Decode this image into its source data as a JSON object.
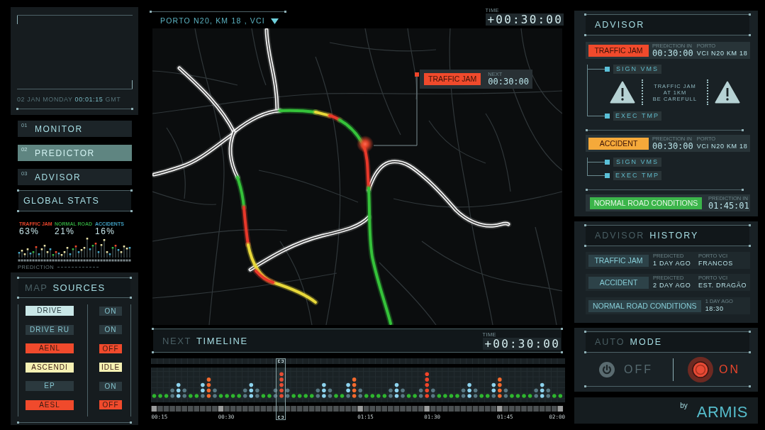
{
  "clock": {
    "date": "02 JAN MONDAY",
    "time": "00:01:15",
    "zone": "GMT"
  },
  "nav": [
    {
      "number": "01",
      "label": "MONITOR",
      "selected": false
    },
    {
      "number": "02",
      "label": "PREDICTOR",
      "selected": true
    },
    {
      "number": "03",
      "label": "ADVISOR",
      "selected": false
    }
  ],
  "global_stats": {
    "title": "GLOBAL STATS",
    "stats": [
      {
        "label": "TRAFFIC JAM",
        "value": "63%",
        "color": "#e8452c"
      },
      {
        "label": "NORMAL ROAD",
        "value": "21%",
        "color": "#2e9e3a"
      },
      {
        "label": "ACCIDENTS",
        "value": "16%",
        "color": "#3f9ec0"
      }
    ],
    "chart_label": "PREDICTION"
  },
  "map_sources": {
    "title_prefix": "MAP",
    "title": "SOURCES",
    "sources": [
      {
        "name": "DRIVE",
        "status": "ON",
        "color": "#2b393e",
        "selected": true
      },
      {
        "name": "DRIVE RU",
        "status": "ON",
        "color": "#2b393e",
        "selected": false
      },
      {
        "name": "AENL",
        "status": "OFF",
        "color": "#f04a2c",
        "selected": false
      },
      {
        "name": "ASCENDI",
        "status": "IDLE",
        "color": "#f5f1b3",
        "selected": false
      },
      {
        "name": "EP",
        "status": "ON",
        "color": "#2b393e",
        "selected": false
      },
      {
        "name": "AESL",
        "status": "OFF",
        "color": "#f04a2c",
        "selected": false
      }
    ]
  },
  "map": {
    "location": "PORTO N20, KM 18 , VCI",
    "time_label": "TIME",
    "time": "+00:30:00",
    "callout": {
      "event": "TRAFFIC JAM",
      "label": "NEXT",
      "time": "00:30:00"
    }
  },
  "timeline": {
    "title_prefix": "NEXT",
    "title": "TIMELINE",
    "time_label": "TIME",
    "time": "+00:30:00",
    "ticks": [
      "00:15",
      "00:30",
      "01:15",
      "01:30",
      "01:45",
      "02:00"
    ]
  },
  "advisor": {
    "title": "ADVISOR",
    "alerts": [
      {
        "event": "TRAFFIC JAM",
        "color": "#f04a2c",
        "fields": [
          {
            "label": "PREDICTION IN",
            "value": "00:30:00"
          },
          {
            "label": "PORTO",
            "value": "VCI N20 KM 18"
          }
        ],
        "actions": [
          {
            "kind": "button",
            "label": "SIGN VMS"
          },
          {
            "kind": "sign",
            "lines": [
              "TRAFFIC JAM",
              "AT 1KM",
              "BE CAREFULL"
            ]
          },
          {
            "kind": "button",
            "label": "EXEC TMP"
          }
        ]
      },
      {
        "event": "ACCIDENT",
        "color": "#f5a93a",
        "fields": [
          {
            "label": "PREDICTION IN",
            "value": "00:30:00"
          },
          {
            "label": "PORTO",
            "value": "VCI N20 KM 18"
          }
        ],
        "actions": [
          {
            "kind": "button",
            "label": "SIGN VMS"
          },
          {
            "kind": "button",
            "label": "EXEC TMP"
          }
        ]
      },
      {
        "event": "NORMAL ROAD CONDITIONS",
        "color": "#3bb54a",
        "fields": [
          {
            "label": "PREDICTION IN",
            "value": "01:45:01"
          }
        ]
      }
    ]
  },
  "history": {
    "title_prefix": "ADVISOR",
    "title": "HISTORY",
    "items": [
      {
        "event": "TRAFFIC JAM",
        "fields": [
          {
            "label": "PREDICTED",
            "value": "1 DAY AGO"
          },
          {
            "label": "PORTO VCI",
            "value": "FRANCOS"
          }
        ]
      },
      {
        "event": "ACCIDENT",
        "fields": [
          {
            "label": "PREDICTED",
            "value": "2 DAY AGO"
          },
          {
            "label": "PORTO VCI",
            "value": "EST. DRAGÃO"
          }
        ]
      },
      {
        "event": "NORMAL ROAD CONDITIONS",
        "fields": [
          {
            "label": "1 DAY AGO",
            "value": "18:30"
          }
        ]
      }
    ]
  },
  "auto_mode": {
    "title_prefix": "AUTO",
    "title": "MODE",
    "options": [
      {
        "kind": "power",
        "label": "OFF",
        "selected": false
      },
      {
        "kind": "record",
        "label": "ON",
        "selected": true
      }
    ]
  },
  "footer": {
    "by": "by",
    "brand": "ARMIS"
  }
}
